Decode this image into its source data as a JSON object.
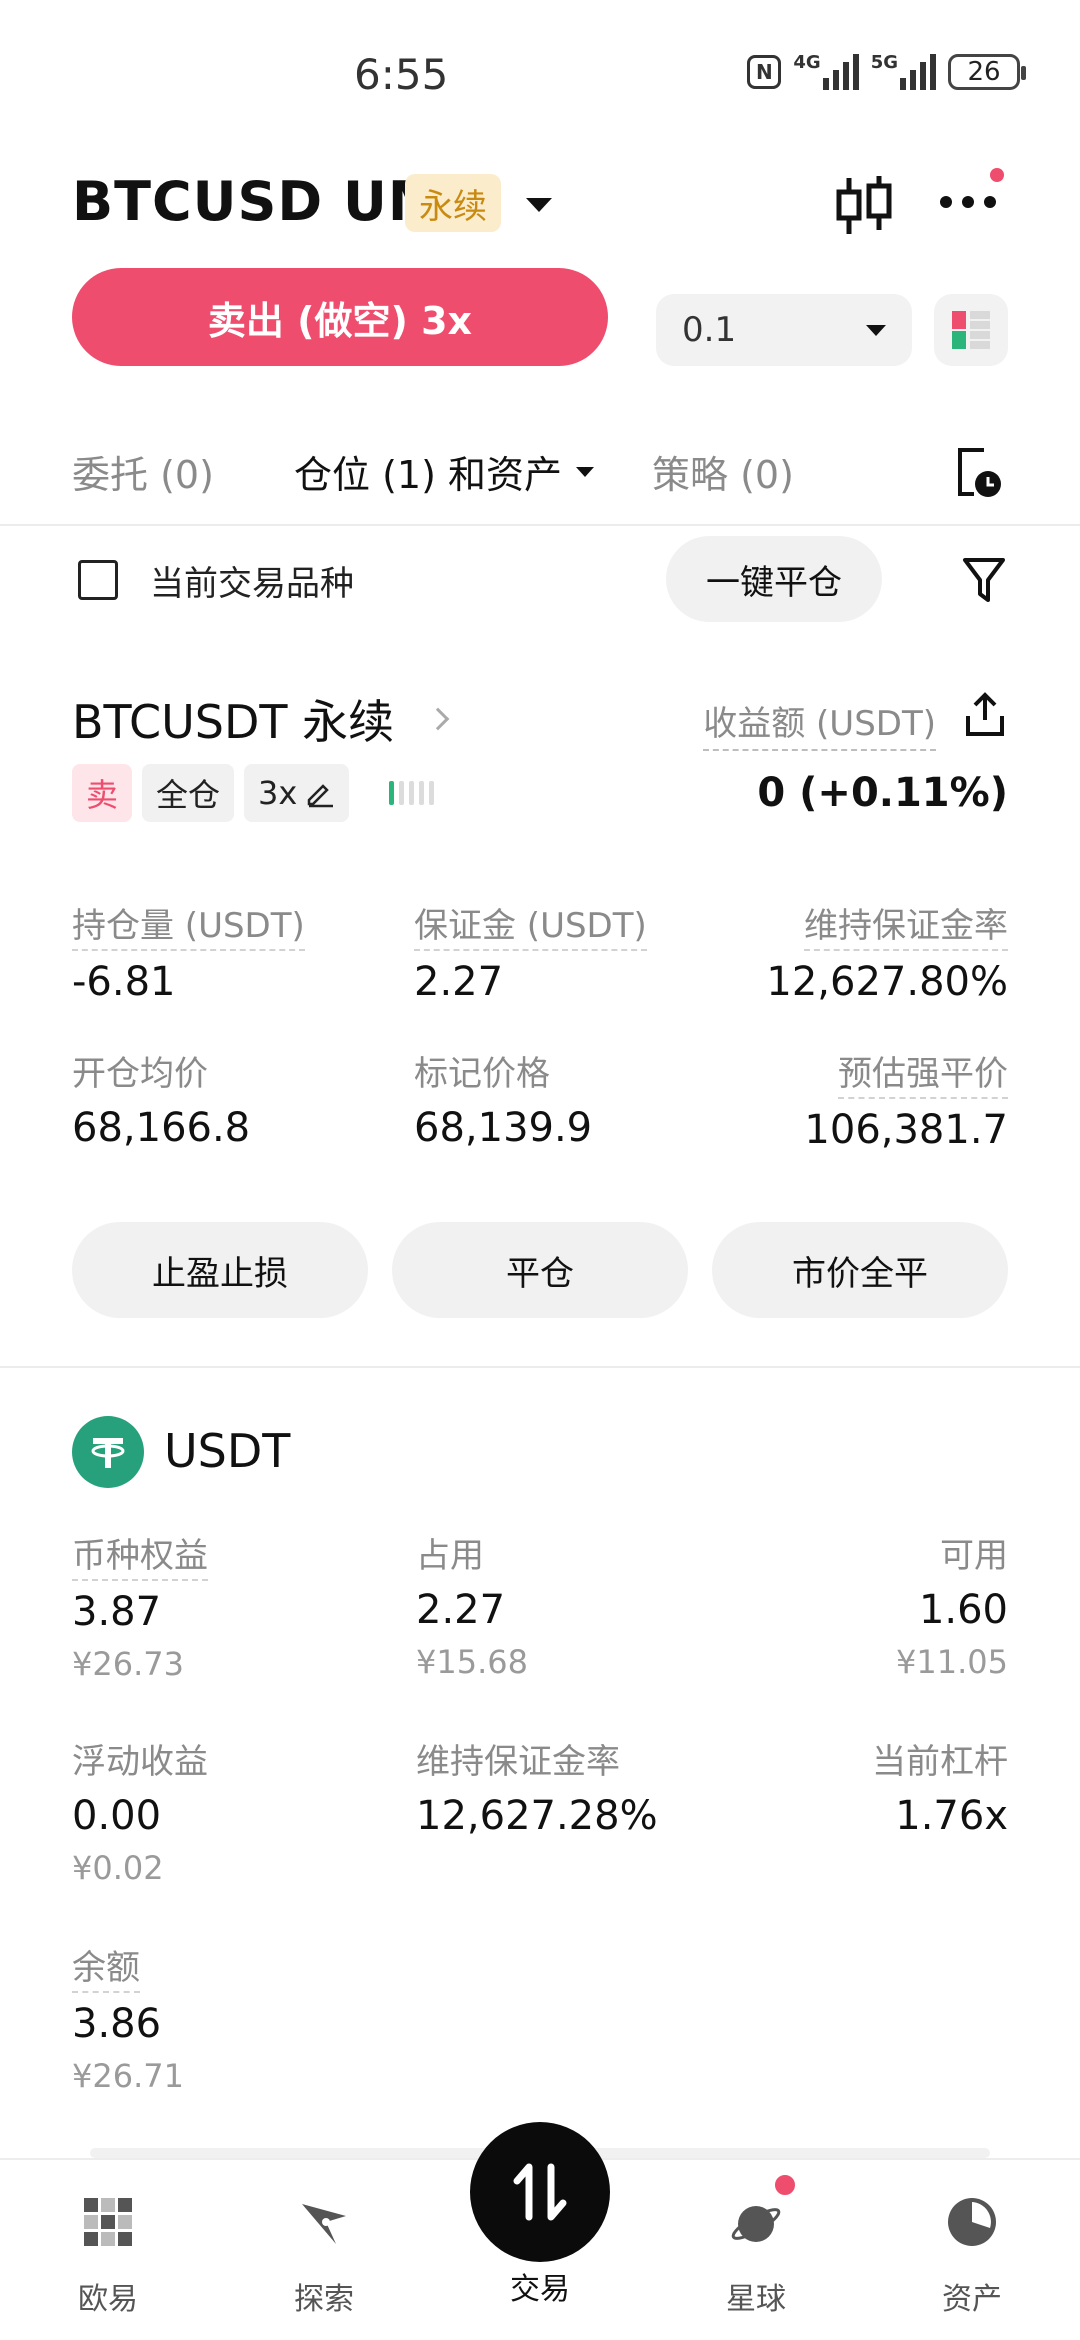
{
  "status_bar": {
    "time": "6:55",
    "nfc": "N",
    "network_1": "4G",
    "network_2": "5G",
    "battery": "26"
  },
  "header": {
    "pair": "BTCUSD UM",
    "badge": "永续"
  },
  "trade": {
    "sell_label": "卖出 (做空) 3x",
    "quantity": "0.1"
  },
  "tabs": {
    "orders": "委托 (0)",
    "positions": "仓位 (1) 和资产",
    "strategies": "策略 (0)"
  },
  "filter": {
    "current_only": "当前交易品种",
    "close_all": "一键平仓"
  },
  "position": {
    "title": "BTCUSDT 永续",
    "pnl_label": "收益额 (USDT)",
    "pnl_value": "0 (+0.11%)",
    "side_tag": "卖",
    "margin_mode": "全仓",
    "leverage": "3x",
    "risk_level": 0.2,
    "stats": {
      "size_label": "持仓量 (USDT)",
      "size_value": "-6.81",
      "margin_label": "保证金 (USDT)",
      "margin_value": "2.27",
      "mmr_label": "维持保证金率",
      "mmr_value": "12,627.80%",
      "entry_label": "开仓均价",
      "entry_value": "68,166.8",
      "mark_label": "标记价格",
      "mark_value": "68,139.9",
      "liq_label": "预估强平价",
      "liq_value": "106,381.7"
    },
    "actions": {
      "tp_sl": "止盈止损",
      "close": "平仓",
      "market_close": "市价全平"
    }
  },
  "asset": {
    "currency": "USDT",
    "equity_label": "币种权益",
    "equity_value": "3.87",
    "equity_cny": "¥26.73",
    "used_label": "占用",
    "used_value": "2.27",
    "used_cny": "¥15.68",
    "available_label": "可用",
    "available_value": "1.60",
    "available_cny": "¥11.05",
    "upl_label": "浮动收益",
    "upl_value": "0.00",
    "upl_cny": "¥0.02",
    "mmr_label": "维持保证金率",
    "mmr_value": "12,627.28%",
    "leverage_label": "当前杠杆",
    "leverage_value": "1.76x",
    "balance_label": "余额",
    "balance_value": "3.86",
    "balance_cny": "¥26.71"
  },
  "nav": {
    "home": "欧易",
    "discover": "探索",
    "trade": "交易",
    "planet": "星球",
    "assets": "资产"
  },
  "colors": {
    "sell": "#ee4d6e",
    "badge_bg": "#fbeccb",
    "badge_text": "#c98a12",
    "usdt": "#26a17b",
    "gain": "#2bb57a"
  }
}
